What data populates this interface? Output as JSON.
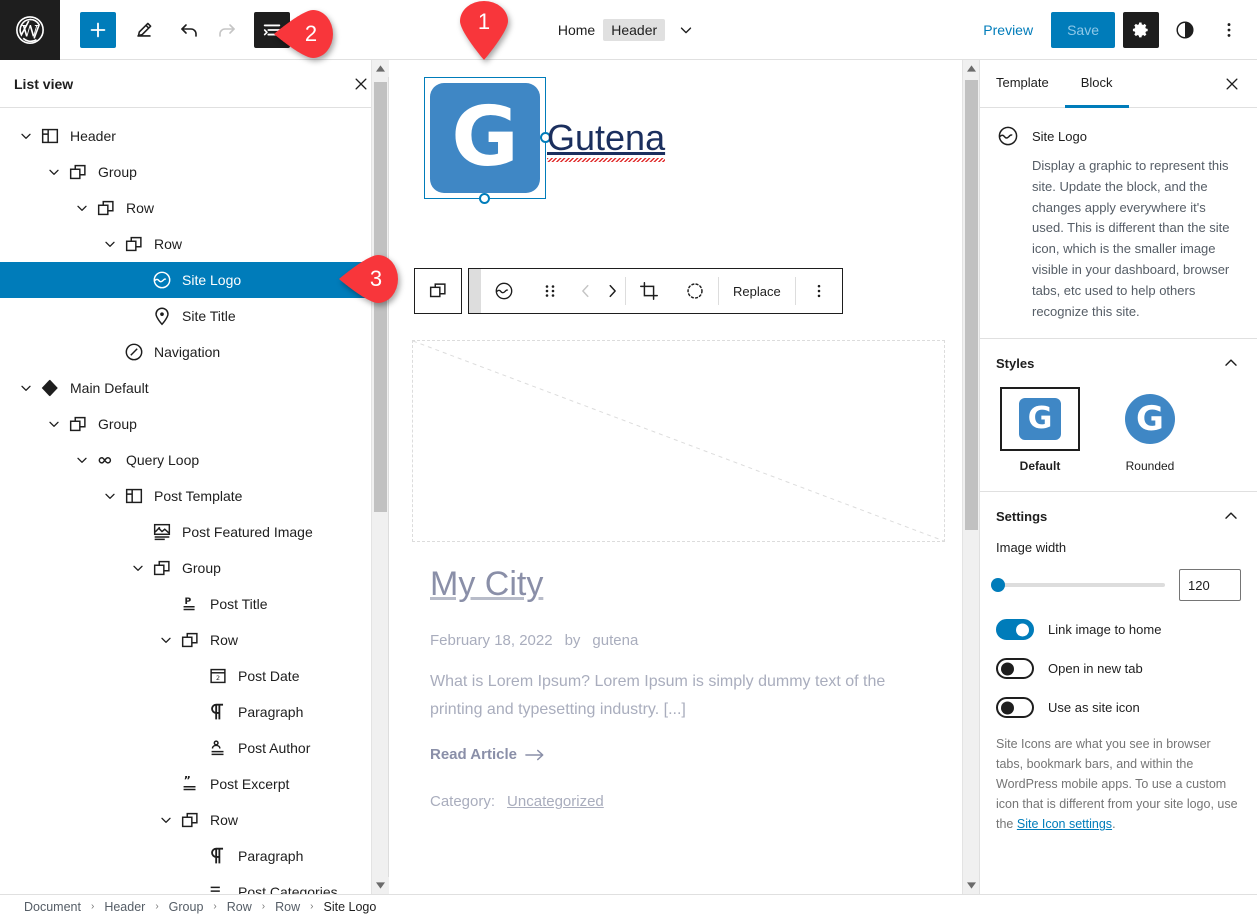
{
  "topbar": {
    "wp_logo": "wordpress-logo",
    "add_block_label": "+",
    "doc_home": "Home",
    "doc_chip": "Header",
    "preview_label": "Preview",
    "save_label": "Save",
    "accent_blue": "#007cba",
    "dark": "#1e1e1e"
  },
  "listview": {
    "title": "List view",
    "rows": [
      {
        "label": "Header",
        "indent": 0,
        "icon": "template-part-icon",
        "chevron": true,
        "selected": false
      },
      {
        "label": "Group",
        "indent": 1,
        "icon": "group-icon",
        "chevron": true,
        "selected": false
      },
      {
        "label": "Row",
        "indent": 2,
        "icon": "group-icon",
        "chevron": true,
        "selected": false
      },
      {
        "label": "Row",
        "indent": 3,
        "icon": "group-icon",
        "chevron": true,
        "selected": false
      },
      {
        "label": "Site Logo",
        "indent": 4,
        "icon": "site-logo-icon",
        "chevron": false,
        "selected": true
      },
      {
        "label": "Site Title",
        "indent": 4,
        "icon": "map-pin-icon",
        "chevron": false,
        "selected": false
      },
      {
        "label": "Navigation",
        "indent": 3,
        "icon": "navigation-icon",
        "chevron": false,
        "selected": false
      },
      {
        "label": "Main Default",
        "indent": 0,
        "icon": "diamond-icon",
        "chevron": true,
        "selected": false
      },
      {
        "label": "Group",
        "indent": 1,
        "icon": "group-icon",
        "chevron": true,
        "selected": false
      },
      {
        "label": "Query Loop",
        "indent": 2,
        "icon": "loop-icon",
        "chevron": true,
        "selected": false
      },
      {
        "label": "Post Template",
        "indent": 3,
        "icon": "template-part-icon",
        "chevron": true,
        "selected": false
      },
      {
        "label": "Post Featured Image",
        "indent": 4,
        "icon": "image-icon",
        "chevron": false,
        "selected": false
      },
      {
        "label": "Group",
        "indent": 4,
        "icon": "group-icon",
        "chevron": true,
        "selected": false
      },
      {
        "label": "Post Title",
        "indent": 5,
        "icon": "post-title-icon",
        "chevron": false,
        "selected": false
      },
      {
        "label": "Row",
        "indent": 5,
        "icon": "group-icon",
        "chevron": true,
        "selected": false
      },
      {
        "label": "Post Date",
        "indent": 6,
        "icon": "calendar-icon",
        "chevron": false,
        "selected": false
      },
      {
        "label": "Paragraph",
        "indent": 6,
        "icon": "paragraph-icon",
        "chevron": false,
        "selected": false
      },
      {
        "label": "Post Author",
        "indent": 6,
        "icon": "author-icon",
        "chevron": false,
        "selected": false
      },
      {
        "label": "Post Excerpt",
        "indent": 5,
        "icon": "excerpt-icon",
        "chevron": false,
        "selected": false
      },
      {
        "label": "Row",
        "indent": 5,
        "icon": "group-icon",
        "chevron": true,
        "selected": false
      },
      {
        "label": "Paragraph",
        "indent": 6,
        "icon": "paragraph-icon",
        "chevron": false,
        "selected": false
      },
      {
        "label": "Post Categories",
        "indent": 6,
        "icon": "categories-icon",
        "chevron": false,
        "selected": false
      }
    ]
  },
  "canvas": {
    "site_logo_letter": "G",
    "site_logo_color": "#3f87c5",
    "site_title": "Gutena",
    "toolbar": {
      "replace_label": "Replace"
    },
    "post": {
      "title": "My City",
      "date": "February 18, 2022",
      "by_label": "by",
      "author": "gutena",
      "excerpt": "What is Lorem Ipsum? Lorem Ipsum is simply dummy text of the printing and typesetting industry. [...]",
      "read_more": "Read Article",
      "category_label": "Category:",
      "category_value": "Uncategorized"
    }
  },
  "sidebar": {
    "tabs": [
      {
        "label": "Template",
        "active": false
      },
      {
        "label": "Block",
        "active": true
      }
    ],
    "block": {
      "name": "Site Logo",
      "description": "Display a graphic to represent this site. Update the block, and the changes apply everywhere it's used. This is different than the site icon, which is the smaller image visible in your dashboard, browser tabs, etc used to help others recognize this site."
    },
    "styles": {
      "title": "Styles",
      "options": [
        {
          "label": "Default",
          "selected": true,
          "shape": "square"
        },
        {
          "label": "Rounded",
          "selected": false,
          "shape": "circle"
        }
      ]
    },
    "settings": {
      "title": "Settings",
      "image_width_label": "Image width",
      "image_width_value": "120",
      "toggles": [
        {
          "label": "Link image to home",
          "on": true
        },
        {
          "label": "Open in new tab",
          "on": false
        },
        {
          "label": "Use as site icon",
          "on": false
        }
      ],
      "help_pre": "Site Icons are what you see in browser tabs, bookmark bars, and within the WordPress mobile apps. To use a custom icon that is different from your site logo, use the ",
      "help_link": "Site Icon settings",
      "help_post": "."
    }
  },
  "breadcrumb": {
    "items": [
      "Document",
      "Header",
      "Group",
      "Row",
      "Row",
      "Site Logo"
    ],
    "separator": "›"
  },
  "markers": [
    {
      "id": "1",
      "label": "1",
      "color": "#f8363b",
      "direction": "down"
    },
    {
      "id": "2",
      "label": "2",
      "color": "#f8363b",
      "direction": "left"
    },
    {
      "id": "3",
      "label": "3",
      "color": "#f8363b",
      "direction": "left"
    }
  ]
}
